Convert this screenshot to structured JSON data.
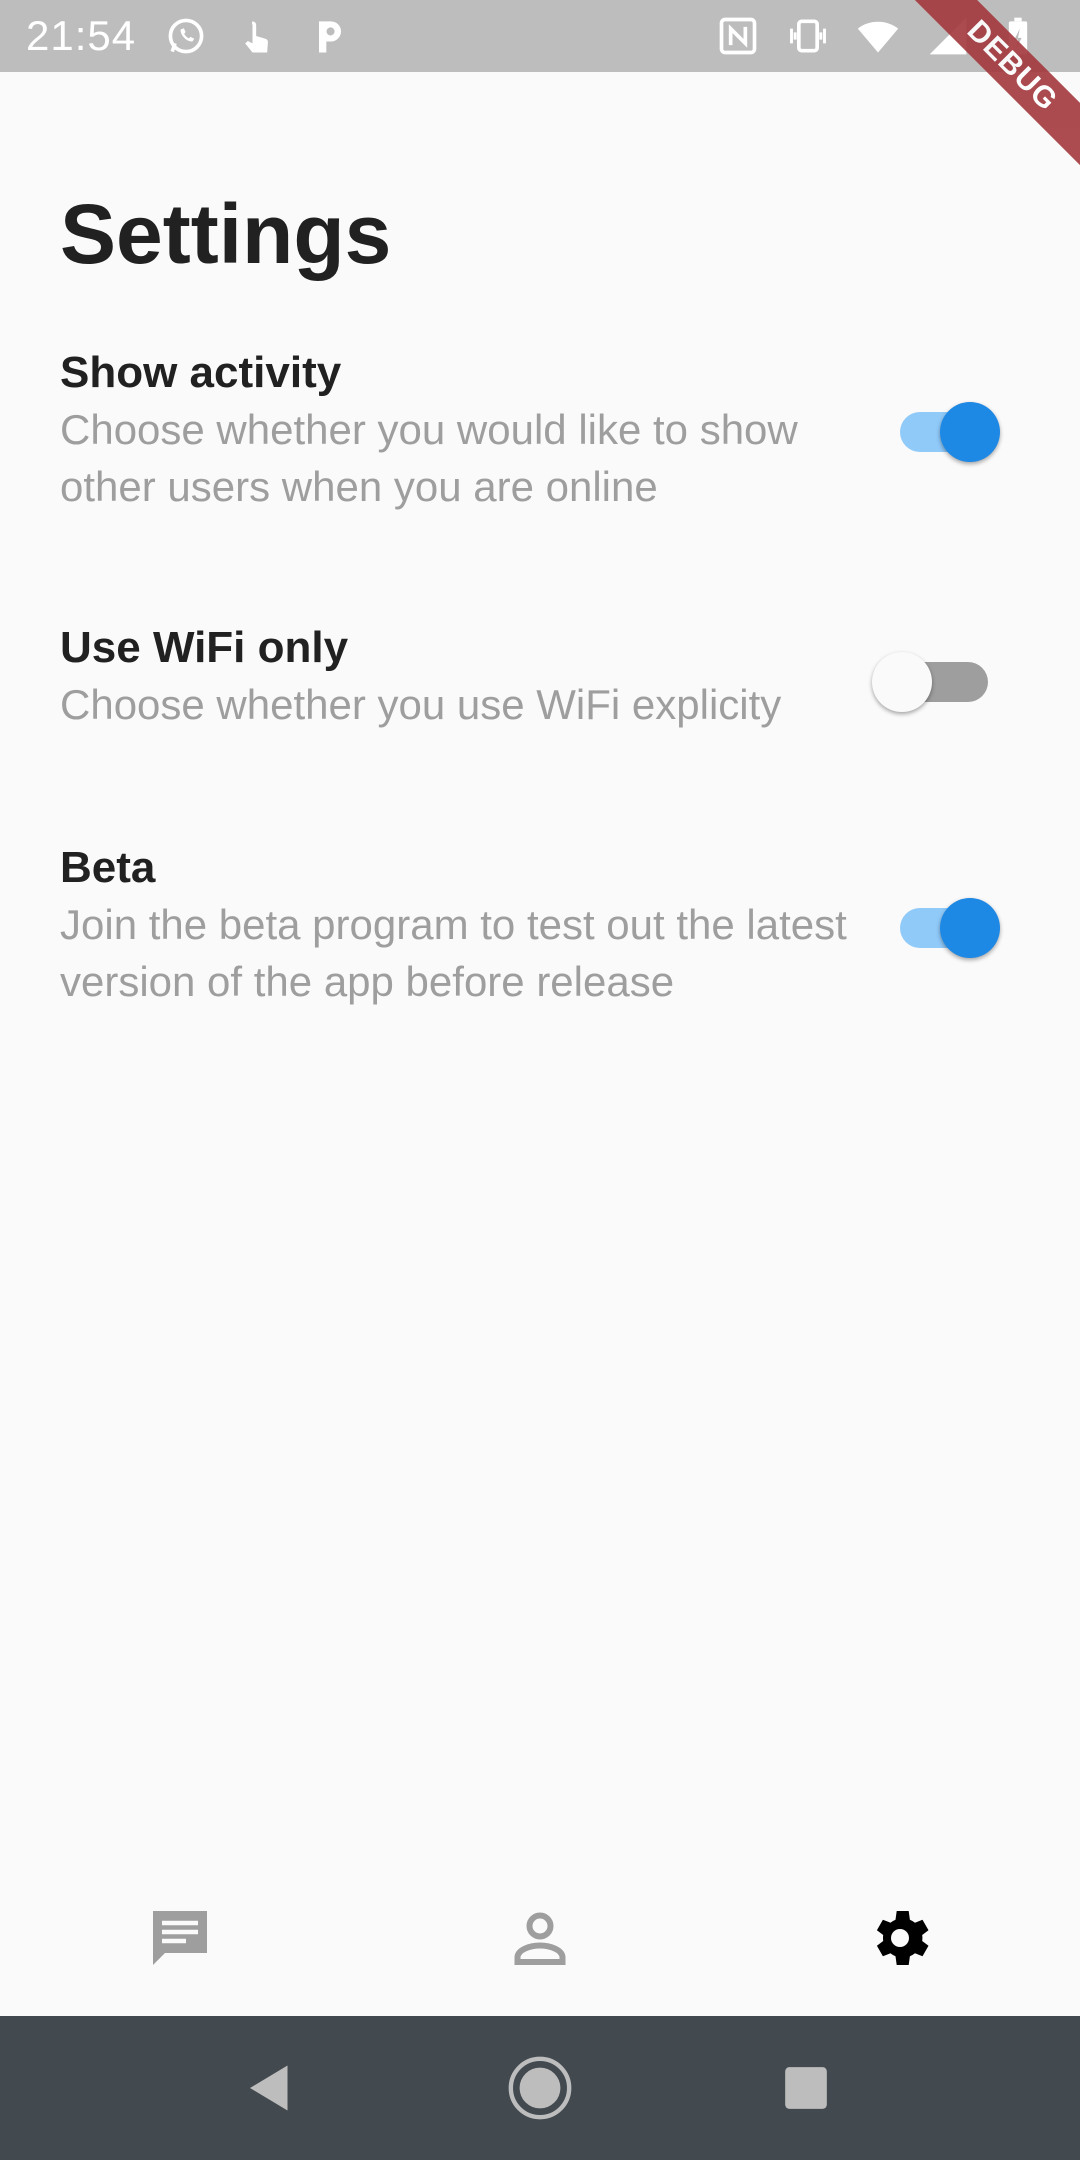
{
  "status_bar": {
    "time": "21:54",
    "left_icons": [
      "whatsapp-icon",
      "touch-icon",
      "p-icon"
    ],
    "right_icons": [
      "nfc-icon",
      "vibrate-icon",
      "wifi-icon",
      "signal-icon",
      "battery-icon"
    ],
    "background": "#BDBDBD"
  },
  "debug_banner": {
    "label": "DEBUG"
  },
  "page": {
    "title": "Settings"
  },
  "settings": [
    {
      "title": "Show activity",
      "description": "Choose whether you would like to show other users when you are online",
      "enabled": true
    },
    {
      "title": "Use WiFi only",
      "description": "Choose whether you use WiFi explicity",
      "enabled": false
    },
    {
      "title": "Beta",
      "description": "Join the beta program to test out the latest version of the app before release",
      "enabled": true
    }
  ],
  "bottom_nav": {
    "items": [
      {
        "icon": "chat-icon",
        "active": false
      },
      {
        "icon": "person-icon",
        "active": false
      },
      {
        "icon": "settings-gear-icon",
        "active": true
      }
    ]
  },
  "system_nav": {
    "buttons": [
      "back-icon",
      "home-icon",
      "recents-icon"
    ]
  },
  "colors": {
    "accent": "#1E88E5",
    "accent_track": "#90CAF9",
    "muted_text": "#9E9E9E",
    "system_nav_bg": "#424A50"
  }
}
